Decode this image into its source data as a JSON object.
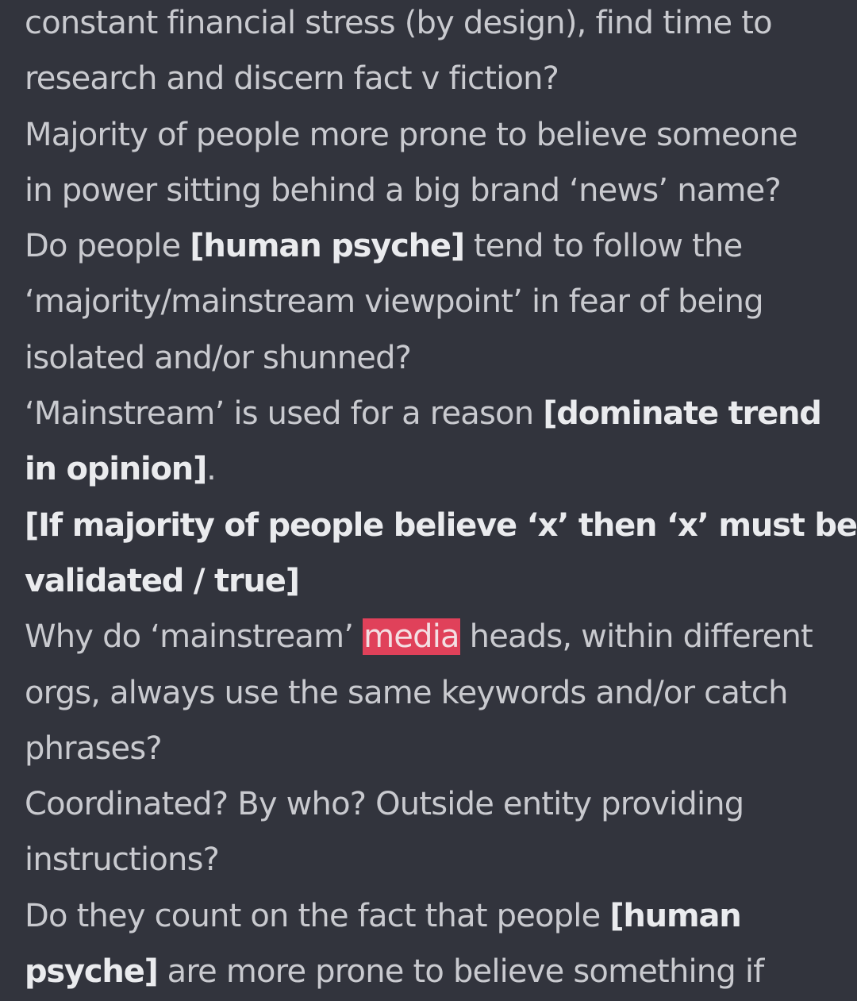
{
  "note": {
    "lines": [
      [
        {
          "text": "constant financial stress (by design), find time to",
          "style": "plain"
        }
      ],
      [
        {
          "text": "research and discern fact v fiction?",
          "style": "plain"
        }
      ],
      [
        {
          "text": "Majority of people more prone to believe someone",
          "style": "plain"
        }
      ],
      [
        {
          "text": "in power sitting behind a big brand ‘news’ name?",
          "style": "plain"
        }
      ],
      [
        {
          "text": "Do people ",
          "style": "plain"
        },
        {
          "text": "[human psyche]",
          "style": "bold"
        },
        {
          "text": " tend to follow the",
          "style": "plain"
        }
      ],
      [
        {
          "text": "‘majority/mainstream viewpoint’ in fear of being",
          "style": "plain"
        }
      ],
      [
        {
          "text": "isolated and/or shunned?",
          "style": "plain"
        }
      ],
      [
        {
          "text": "‘Mainstream’ is used for a reason ",
          "style": "plain"
        },
        {
          "text": "[dominate trend",
          "style": "bold"
        }
      ],
      [
        {
          "text": "in opinion]",
          "style": "bold"
        },
        {
          "text": ".",
          "style": "plain"
        }
      ],
      [
        {
          "text": "[If majority of people believe ‘x’ then ‘x’ must be",
          "style": "bold"
        }
      ],
      [
        {
          "text": "validated / true]",
          "style": "bold"
        }
      ],
      [
        {
          "text": "Why do ‘mainstream’ ",
          "style": "plain"
        },
        {
          "text": "media",
          "style": "highlight"
        },
        {
          "text": " heads, within different",
          "style": "plain"
        }
      ],
      [
        {
          "text": "orgs, always use the same keywords and/or catch",
          "style": "plain"
        }
      ],
      [
        {
          "text": "phrases?",
          "style": "plain"
        }
      ],
      [
        {
          "text": "Coordinated? By who? Outside entity providing",
          "style": "plain"
        }
      ],
      [
        {
          "text": "instructions?",
          "style": "plain"
        }
      ],
      [
        {
          "text": "Do they count on the fact that people ",
          "style": "plain"
        },
        {
          "text": "[human",
          "style": "bold"
        }
      ],
      [
        {
          "text": "psyche]",
          "style": "bold"
        },
        {
          "text": " are more prone to believe something if",
          "style": "plain"
        }
      ]
    ]
  },
  "colors": {
    "background": "#32343d",
    "body_text": "#c9cacf",
    "bold_text": "#eaebee",
    "search_highlight": "#e0415a"
  }
}
